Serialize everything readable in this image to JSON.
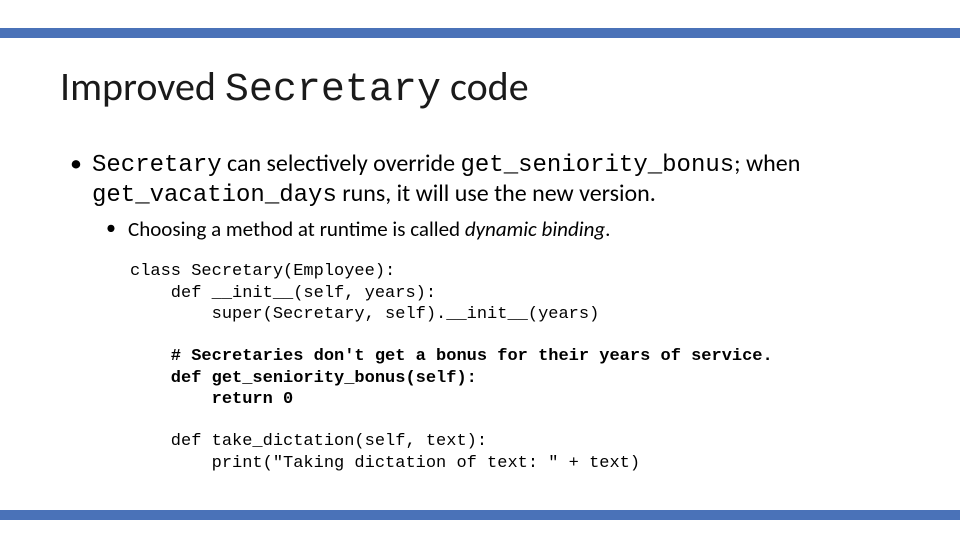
{
  "title": {
    "pre": "Improved ",
    "code": "Secretary",
    "post": " code"
  },
  "bullet1": {
    "t1": "Secretary",
    "t2": " can selectively override ",
    "t3": "get_seniority_bonus",
    "t4": "; when ",
    "t5": "get_vacation_days",
    "t6": " runs, it will use the new version."
  },
  "bullet2": {
    "t1": "Choosing a method at runtime is called ",
    "t2": "dynamic binding",
    "t3": "."
  },
  "code": {
    "l1": "class Secretary(Employee):",
    "l2": "    def __init__(self, years):",
    "l3": "        super(Secretary, self).__init__(years)",
    "l4": "",
    "l5": "    # Secretaries don't get a bonus for their years of service.",
    "l6": "    def get_seniority_bonus(self):",
    "l7": "        return 0",
    "l8": "",
    "l9": "    def take_dictation(self, text):",
    "l10": "        print(\"Taking dictation of text: \" + text)"
  }
}
